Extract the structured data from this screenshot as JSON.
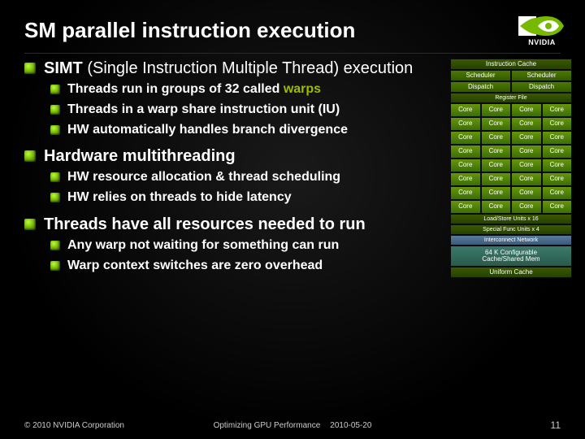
{
  "title": "SM parallel instruction execution",
  "logo_text": "NVIDIA",
  "sections": [
    {
      "heading_parts": [
        "SIMT",
        " (Single Instruction Multiple Thread) execution"
      ],
      "subs": [
        {
          "pre": "Threads run in groups of 32 called ",
          "hl": "warps",
          "post": ""
        },
        {
          "pre": "Threads in a warp share instruction unit (IU)",
          "hl": "",
          "post": ""
        },
        {
          "pre": "HW automatically handles branch divergence",
          "hl": "",
          "post": ""
        }
      ]
    },
    {
      "heading_parts": [
        "Hardware multithreading",
        ""
      ],
      "subs": [
        {
          "pre": "HW resource allocation & thread scheduling",
          "hl": "",
          "post": ""
        },
        {
          "pre": "HW relies on threads to hide latency",
          "hl": "",
          "post": ""
        }
      ]
    },
    {
      "heading_parts": [
        "Threads have all resources needed to run",
        ""
      ],
      "subs": [
        {
          "pre": "Any warp not waiting for something can run",
          "hl": "",
          "post": ""
        },
        {
          "pre": "Warp context switches are zero overhead",
          "hl": "",
          "post": ""
        }
      ]
    }
  ],
  "diagram": {
    "icache": "Instruction Cache",
    "scheduler": "Scheduler",
    "dispatch": "Dispatch",
    "register": "Register File",
    "core": "Core",
    "core_rows": 8,
    "loadstore": "Load/Store Units x 16",
    "sfu": "Special Func Units x 4",
    "interconnect": "Interconnect Network",
    "cache64": "64 K Configurable\nCache/Shared Mem",
    "uniform": "Uniform Cache"
  },
  "footer": {
    "copyright": "© 2010 NVIDIA Corporation",
    "mid1": "Optimizing GPU Performance",
    "mid2": "2010-05-20",
    "page": "11"
  }
}
